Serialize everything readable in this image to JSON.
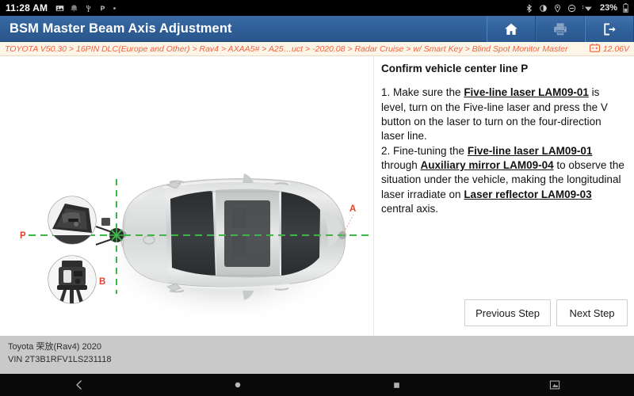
{
  "statusbar": {
    "clock": "11:28 AM",
    "left_icons": [
      "image-icon",
      "vibrate-icon",
      "usb-icon",
      "parking-p-icon",
      "dot-icon"
    ],
    "right_icons": [
      "bluetooth-icon",
      "brightness-icon",
      "location-icon",
      "dnd-icon",
      "wifi-signal-icon"
    ],
    "battery_percent": "23%",
    "battery_icon": "battery-icon"
  },
  "titlebar": {
    "title": "BSM Master Beam Axis Adjustment",
    "buttons": [
      {
        "name": "home-button",
        "icon": "home-icon",
        "enabled": true
      },
      {
        "name": "print-button",
        "icon": "printer-icon",
        "enabled": false
      },
      {
        "name": "exit-button",
        "icon": "exit-icon",
        "enabled": true
      }
    ]
  },
  "breadcrumb": {
    "path": "TOYOTA V50.30 > 16PIN DLC(Europe and Other) > Rav4 > AXAA5# > A25…uct > -2020.08 > Radar Cruise > w/ Smart Key > Blind Spot Monitor Master",
    "voltage": "12.06V",
    "voltage_icon": "battery-icon",
    "accent_color": "#f4603c",
    "background_color": "#fdf6e8"
  },
  "diagram": {
    "labels": {
      "point_p": "P",
      "point_a": "A",
      "point_b": "B"
    },
    "laser_line_color": "#3cb54a",
    "label_color": "#e8402a",
    "callout_top": "five-line-laser-device-photo",
    "callout_bottom": "laser-level-tripod-photo",
    "vehicle": "toyota-rav4-top-view"
  },
  "instructions": {
    "title": "Confirm vehicle center line P",
    "step1": {
      "prefix": "1. Make sure the ",
      "term1": "Five-line laser LAM09-01",
      "middle": " is level, turn on the Five-line laser and press the V button on the laser to turn on the four-direction laser line."
    },
    "step2": {
      "prefix": "2. Fine-tuning the ",
      "term1": "Five-line laser LAM09-01",
      "middle1": " through ",
      "term2": "Auxiliary mirror LAM09-04",
      "middle2": " to observe the situation under the vehicle, making the longitudinal laser irradiate on ",
      "term3": "Laser reflector LAM09-03",
      "suffix": " central axis."
    }
  },
  "actions": {
    "previous_label": "Previous Step",
    "next_label": "Next Step"
  },
  "footer": {
    "vehicle": "Toyota 荣放(Rav4) 2020",
    "vin": "VIN 2T3B1RFV1LS231118"
  },
  "navbar": {
    "items": [
      "back-icon",
      "home-circle-icon",
      "recents-square-icon",
      "screenshot-icon"
    ]
  }
}
